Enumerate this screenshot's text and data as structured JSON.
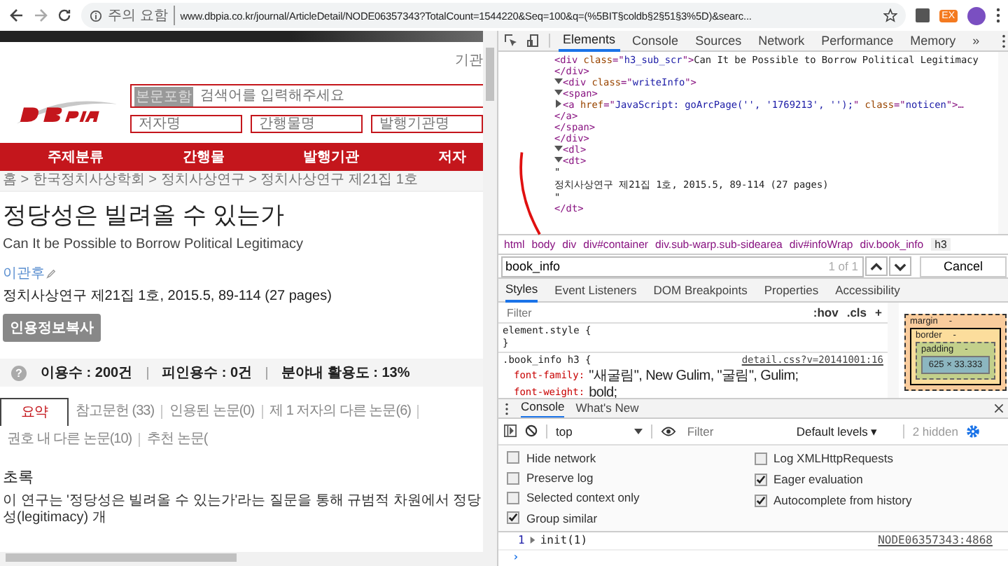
{
  "browser": {
    "security_label": "주의 요함",
    "url": "www.dbpia.co.kr/journal/ArticleDetail/NODE06357343?TotalCount=1544220&Seq=100&q=(%5BIT§coldb§2§51§3%5D)&searc...",
    "extension_badge": "EX"
  },
  "page": {
    "top_link": "기관",
    "search": {
      "scope": "본문포함",
      "placeholder": "검색어를 입력해주세요"
    },
    "subfields": [
      {
        "placeholder": "저자명"
      },
      {
        "placeholder": "간행물명"
      },
      {
        "placeholder": "발행기관명"
      }
    ],
    "nav": [
      "주제분류",
      "간행물",
      "발행기관",
      "저자"
    ],
    "breadcrumb": "홈 > 한국정치사상학회 > 정치사상연구 > 정치사상연구 제21집 1호",
    "title": "정당성은 빌려올 수 있는가",
    "subtitle": "Can It be Possible to Borrow Political Legitimacy",
    "author": "이관후",
    "citation": "정치사상연구 제21집 1호, 2015.5, 89-114 (27 pages)",
    "cite_button": "인용정보복사",
    "help_icon": "?",
    "stats": [
      "이용수 : 200건",
      "피인용수 : 0건",
      "분야내 활용도 : 13%"
    ],
    "tabs": [
      {
        "label": "요약",
        "selected": true
      },
      {
        "label": "참고문헌 (33)",
        "selected": false
      },
      {
        "label": "인용된 논문(0)",
        "selected": false
      },
      {
        "label": "제 1 저자의 다른 논문(6)",
        "selected": false
      },
      {
        "label": "권호 내 다른 논문(10)",
        "selected": false
      },
      {
        "label": "추천 논문(",
        "selected": false
      }
    ],
    "section_heading": "초록",
    "abstract": "이 연구는 '정당성은 빌려올 수 있는가'라는 질문을 통해 규범적 차원에서 정당성(legitimacy) 개"
  },
  "devtools": {
    "tabs": [
      {
        "label": "Elements",
        "selected": true
      },
      {
        "label": "Console",
        "selected": false
      },
      {
        "label": "Sources",
        "selected": false
      },
      {
        "label": "Network",
        "selected": false
      },
      {
        "label": "Performance",
        "selected": false
      },
      {
        "label": "Memory",
        "selected": false
      }
    ],
    "more": "»",
    "tree": [
      {
        "parts": [
          {
            "kind": "tag",
            "text": "<div "
          },
          {
            "kind": "attr",
            "text": "class"
          },
          {
            "kind": "tag",
            "text": "=\""
          },
          {
            "kind": "val",
            "text": "h3_sub_scr"
          },
          {
            "kind": "tag",
            "text": "\">"
          },
          {
            "kind": "txt",
            "text": "Can It be Possible to Borrow Political Legitimacy"
          }
        ]
      },
      {
        "parts": [
          {
            "kind": "tag",
            "text": "</div>"
          }
        ]
      },
      {
        "expanded": true,
        "parts": [
          {
            "kind": "tag",
            "text": "<div "
          },
          {
            "kind": "attr",
            "text": "class"
          },
          {
            "kind": "tag",
            "text": "=\""
          },
          {
            "kind": "val",
            "text": "writeInfo"
          },
          {
            "kind": "tag",
            "text": "\">"
          }
        ],
        "children": [
          {
            "expanded": true,
            "parts": [
              {
                "kind": "tag",
                "text": "<span>"
              }
            ],
            "children": [
              {
                "expanded": false,
                "parts": [
                  {
                    "kind": "tag",
                    "text": "<a "
                  },
                  {
                    "kind": "attr",
                    "text": "href"
                  },
                  {
                    "kind": "tag",
                    "text": "=\""
                  },
                  {
                    "kind": "link",
                    "text": "JavaScript: goArcPage('', '1769213', '');"
                  },
                  {
                    "kind": "tag",
                    "text": "\" "
                  },
                  {
                    "kind": "attr",
                    "text": "class"
                  },
                  {
                    "kind": "tag",
                    "text": "=\""
                  },
                  {
                    "kind": "val",
                    "text": "noticen"
                  },
                  {
                    "kind": "tag",
                    "text": "\">…"
                  }
                ]
              },
              {
                "parts": [
                  {
                    "kind": "tag",
                    "text": "</a>"
                  }
                ]
              }
            ]
          },
          {
            "parts": [
              {
                "kind": "tag",
                "text": "</span>"
              }
            ]
          }
        ]
      },
      {
        "parts": [
          {
            "kind": "tag",
            "text": "</div>"
          }
        ]
      },
      {
        "expanded": true,
        "parts": [
          {
            "kind": "tag",
            "text": "<dl>"
          }
        ],
        "children": [
          {
            "expanded": true,
            "parts": [
              {
                "kind": "tag",
                "text": "<dt>"
              }
            ],
            "children": [
              {
                "parts": [
                  {
                    "kind": "txt",
                    "text": "\""
                  }
                ]
              },
              {
                "parts": [
                  {
                    "kind": "wide",
                    "text": "정치사상연구 제21집 1호,  2015.5, 89-114 (27 pages)"
                  }
                ]
              },
              {
                "parts": [
                  {
                    "kind": "mid",
                    "text": "\""
                  }
                ]
              }
            ]
          },
          {
            "parts": [
              {
                "kind": "tag",
                "text": "</dt>"
              }
            ]
          }
        ]
      }
    ],
    "crumbs": [
      {
        "label": "html",
        "selected": false
      },
      {
        "label": "body",
        "selected": false
      },
      {
        "label": "div",
        "selected": false
      },
      {
        "label": "div#container",
        "selected": false
      },
      {
        "label": "div.sub-warp.sub-sidearea",
        "selected": false
      },
      {
        "label": "div#infoWrap",
        "selected": false
      },
      {
        "label": "div.book_info",
        "selected": false
      },
      {
        "label": "h3",
        "selected": true
      }
    ],
    "find": {
      "value": "book_info",
      "count": "1 of 1",
      "cancel": "Cancel"
    },
    "style_tabs": [
      {
        "label": "Styles",
        "selected": true
      },
      {
        "label": "Event Listeners",
        "selected": false
      },
      {
        "label": "DOM Breakpoints",
        "selected": false
      },
      {
        "label": "Properties",
        "selected": false
      },
      {
        "label": "Accessibility",
        "selected": false
      }
    ],
    "style_filter": {
      "placeholder": "Filter",
      "hov": ":hov",
      "cls": ".cls",
      "add": "+"
    },
    "rules": [
      {
        "selector": "element.style {",
        "close": "}"
      },
      {
        "selector": ".book_info h3 {",
        "source": "detail.css?v=20141001:16",
        "declarations": [
          {
            "prop": "font-family:",
            "value": "\"새굴림\", New Gulim, \"굴림\", Gulim;"
          },
          {
            "prop": "font-weight:",
            "value": "bold;"
          }
        ]
      }
    ],
    "box_model": {
      "margin": "margin",
      "margin_value": "-",
      "border": "border",
      "border_value": "-",
      "padding": "padding",
      "padding_value": "-",
      "content": "625 × 33.333"
    },
    "drawer_tabs": [
      {
        "label": "Console",
        "selected": true
      },
      {
        "label": "What's New",
        "selected": false
      }
    ],
    "console": {
      "context": "top",
      "filter_placeholder": "Filter",
      "levels": "Default levels ▾",
      "hidden": "2 hidden",
      "settings_columns": [
        {
          "items": [
            {
              "label": "Hide network",
              "checked": false
            },
            {
              "label": "Preserve log",
              "checked": false
            },
            {
              "label": "Selected context only",
              "checked": false
            },
            {
              "label": "Group similar",
              "checked": true
            }
          ]
        },
        {
          "items": [
            {
              "label": "Log XMLHttpRequests",
              "checked": false
            },
            {
              "label": "Eager evaluation",
              "checked": true
            },
            {
              "label": "Autocomplete from history",
              "checked": true
            }
          ]
        }
      ],
      "log": {
        "count": "1",
        "message": "init(1)",
        "source": "NODE06357343:4868"
      },
      "prompt": "›"
    }
  }
}
